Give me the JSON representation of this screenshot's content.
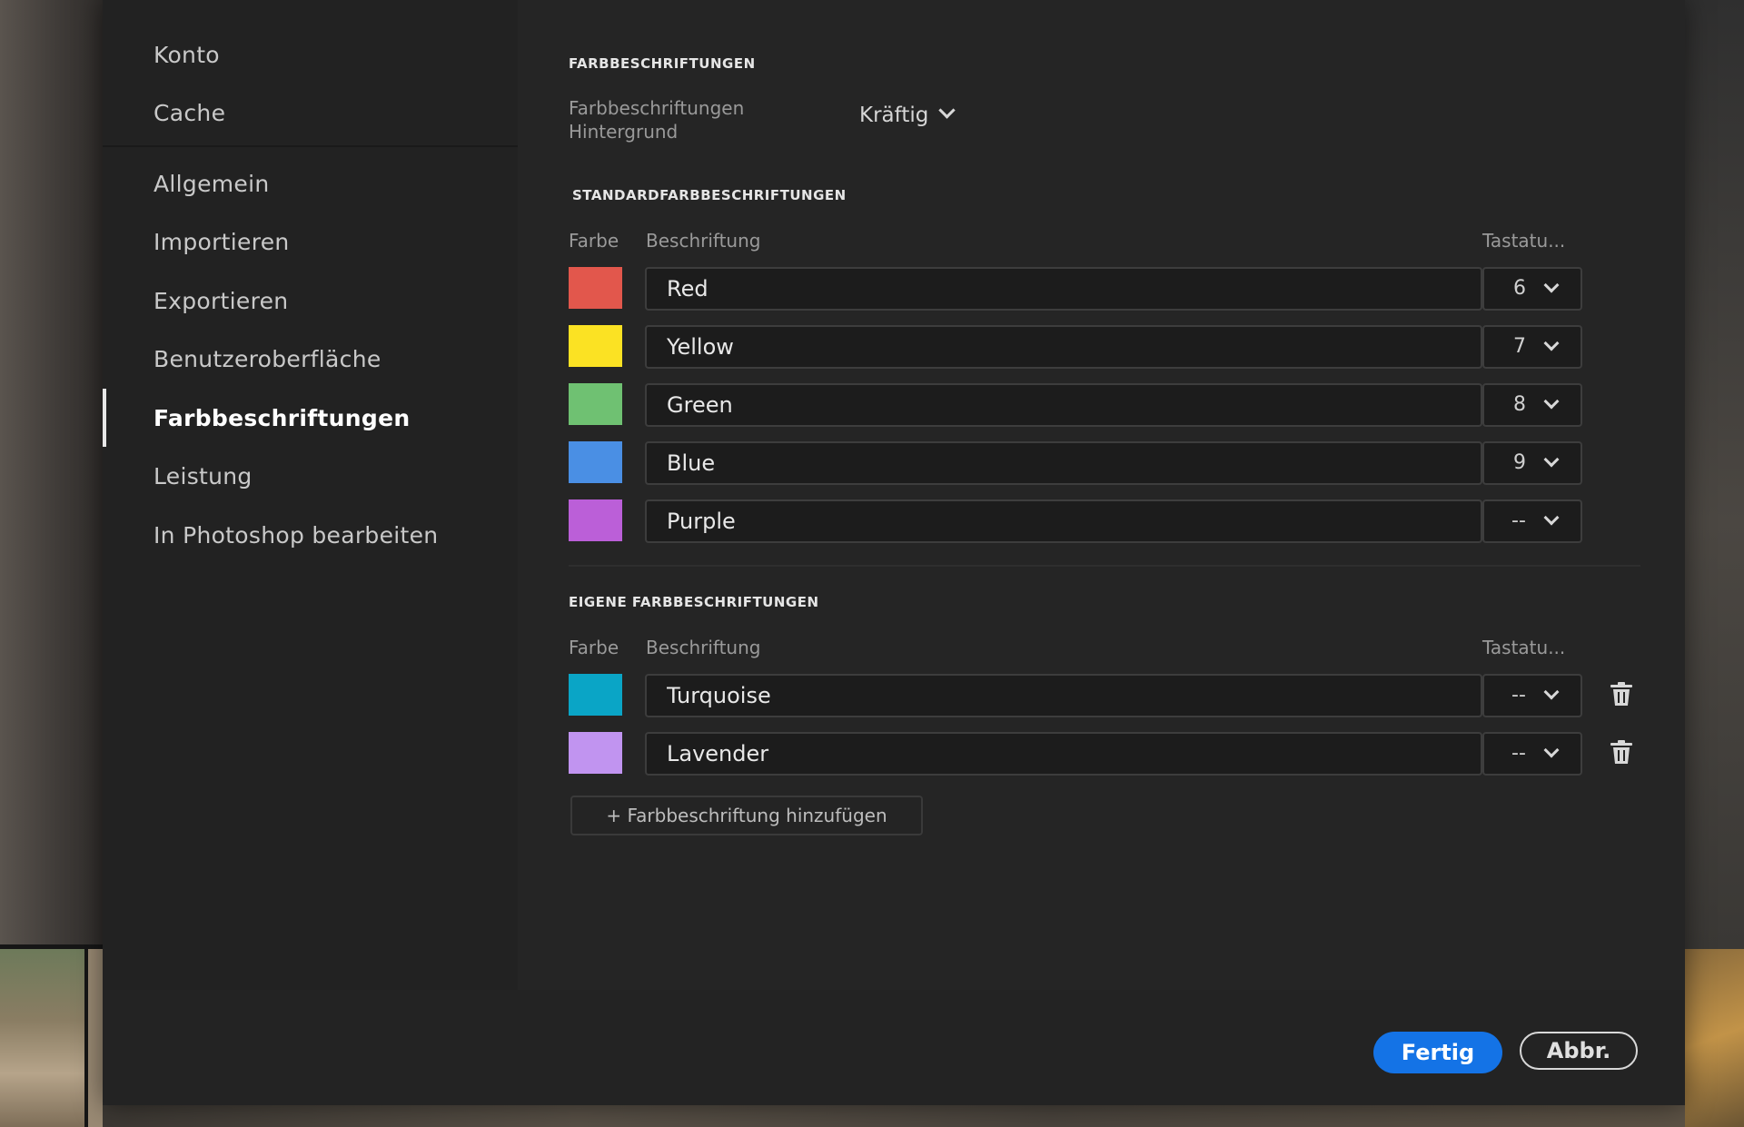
{
  "sidebar": {
    "items": [
      {
        "label": "Konto"
      },
      {
        "label": "Cache"
      },
      {
        "label": "Allgemein"
      },
      {
        "label": "Importieren"
      },
      {
        "label": "Exportieren"
      },
      {
        "label": "Benutzeroberfläche"
      },
      {
        "label": "Farbbeschriftungen"
      },
      {
        "label": "Leistung"
      },
      {
        "label": "In Photoshop bearbeiten"
      }
    ],
    "active_item": "Farbbeschriftungen"
  },
  "main": {
    "section_title": "FARBBESCHRIFTUNGEN",
    "background_setting": {
      "label_line1": "Farbbeschriftungen",
      "label_line2": "Hintergrund",
      "value": "Kräftig"
    },
    "standard": {
      "title": "STANDARDFARBBESCHRIFTUNGEN",
      "col_color": "Farbe",
      "col_label": "Beschriftung",
      "col_key": "Tastatu...",
      "rows": [
        {
          "color": "#e2574c",
          "name": "Red",
          "key": "6"
        },
        {
          "color": "#fbe223",
          "name": "Yellow",
          "key": "7"
        },
        {
          "color": "#6fc172",
          "name": "Green",
          "key": "8"
        },
        {
          "color": "#4a8fe4",
          "name": "Blue",
          "key": "9"
        },
        {
          "color": "#bb5fd8",
          "name": "Purple",
          "key": "--"
        }
      ]
    },
    "custom": {
      "title": "EIGENE FARBBESCHRIFTUNGEN",
      "col_color": "Farbe",
      "col_label": "Beschriftung",
      "col_key": "Tastatu...",
      "rows": [
        {
          "color": "#0aa5c6",
          "name": "Turquoise",
          "key": "--"
        },
        {
          "color": "#c194f0",
          "name": "Lavender",
          "key": "--"
        }
      ],
      "add_label": "+ Farbbeschriftung hinzufügen"
    }
  },
  "footer": {
    "primary_label": "Fertig",
    "secondary_label": "Abbr."
  },
  "colors": {
    "accent": "#1473e6"
  }
}
